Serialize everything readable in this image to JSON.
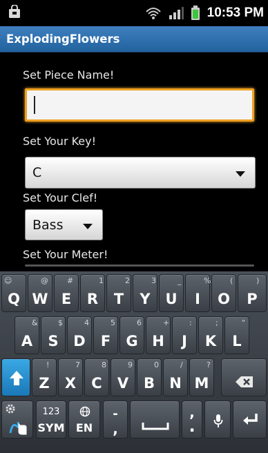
{
  "status_bar": {
    "time": "10:53 PM",
    "icons": [
      "notification-bag-icon",
      "wifi-icon",
      "signal-icon",
      "battery-icon"
    ],
    "battery_color": "#3cc63c"
  },
  "app": {
    "title": "ExplodingFlowers",
    "title_bar_color": "#2f6fae"
  },
  "form": {
    "piece_name_label": "Set Piece Name!",
    "piece_name_value": "",
    "key_label": "Set Your Key!",
    "key_value": "C",
    "clef_label": "Set Your Clef!",
    "clef_value": "Bass",
    "meter_label": "Set Your Meter!"
  },
  "keyboard": {
    "row1": [
      {
        "k": "Q",
        "s": "@",
        "sl": "☺"
      },
      {
        "k": "W",
        "s": "#"
      },
      {
        "k": "E",
        "s": "1"
      },
      {
        "k": "R",
        "s": "2"
      },
      {
        "k": "T",
        "s": "3"
      },
      {
        "k": "Y",
        "s": "_"
      },
      {
        "k": "U",
        "s": "%"
      },
      {
        "k": "I",
        "s": "("
      },
      {
        "k": "O",
        "s": ")"
      },
      {
        "k": "P",
        "s": ""
      }
    ],
    "row2": [
      {
        "k": "A",
        "s": "&"
      },
      {
        "k": "S",
        "s": "$"
      },
      {
        "k": "D",
        "s": "4"
      },
      {
        "k": "F",
        "s": "5"
      },
      {
        "k": "G",
        "s": "6"
      },
      {
        "k": "H",
        "s": "+"
      },
      {
        "k": "J",
        "s": ":"
      },
      {
        "k": "K",
        "s": ";"
      },
      {
        "k": "L",
        "s": "\""
      }
    ],
    "row3": [
      {
        "k": "Z",
        "s": "!"
      },
      {
        "k": "X",
        "s": "7"
      },
      {
        "k": "C",
        "s": "8"
      },
      {
        "k": "V",
        "s": "9"
      },
      {
        "k": "B",
        "s": "0"
      },
      {
        "k": "N",
        "s": "/"
      },
      {
        "k": "M",
        "s": "?"
      }
    ],
    "sym_top": "123",
    "sym_bottom": "SYM",
    "lang": "EN",
    "dash_key": "-",
    "dash_key_sub": ",",
    "period_key": ".",
    "period_key_sub": ","
  }
}
